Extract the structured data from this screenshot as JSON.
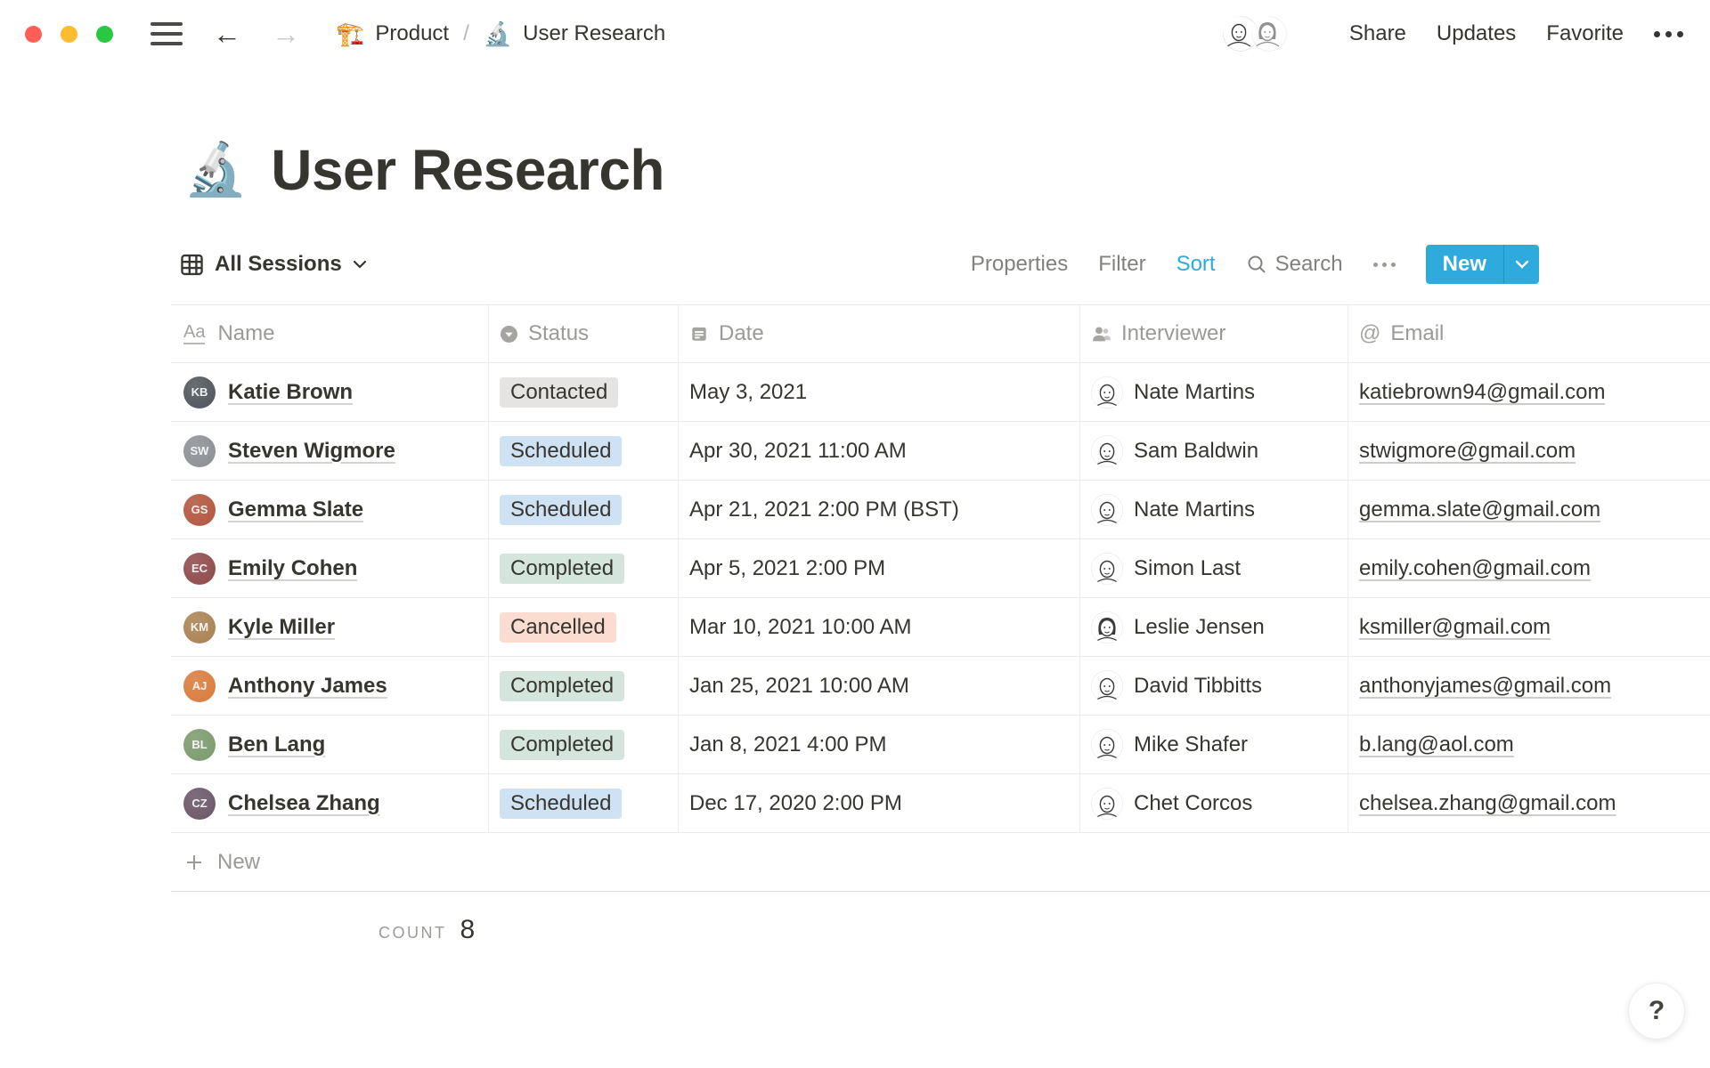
{
  "topbar": {
    "breadcrumb": {
      "workspace_icon": "🏗️",
      "workspace": "Product",
      "separator": "/",
      "page_icon": "🔬",
      "page": "User Research"
    },
    "actions": {
      "share": "Share",
      "updates": "Updates",
      "favorite": "Favorite"
    }
  },
  "page": {
    "icon": "🔬",
    "title": "User Research"
  },
  "toolbar": {
    "view_label": "All Sessions",
    "properties": "Properties",
    "filter": "Filter",
    "sort": "Sort",
    "search": "Search",
    "new_label": "New",
    "accent_color": "#2EAADC"
  },
  "table": {
    "columns": [
      {
        "label": "Name",
        "icon": "text-icon"
      },
      {
        "label": "Status",
        "icon": "select-icon"
      },
      {
        "label": "Date",
        "icon": "calendar-icon"
      },
      {
        "label": "Interviewer",
        "icon": "person-icon"
      },
      {
        "label": "Email",
        "icon": "at-icon"
      }
    ],
    "status_styles": {
      "Contacted": "#E5E4E2",
      "Scheduled": "#CFE2F4",
      "Completed": "#D3E5DC",
      "Cancelled": "#FADCD0"
    },
    "rows": [
      {
        "name": "Katie Brown",
        "status": "Contacted",
        "date": "May 3, 2021",
        "interviewer": "Nate Martins",
        "email": "katiebrown94@gmail.com",
        "avatar_color": "#50565c"
      },
      {
        "name": "Steven Wigmore",
        "status": "Scheduled",
        "date": "Apr 30, 2021 11:00 AM",
        "interviewer": "Sam Baldwin",
        "email": "stwigmore@gmail.com",
        "avatar_color": "#8c8f94"
      },
      {
        "name": "Gemma Slate",
        "status": "Scheduled",
        "date": "Apr 21, 2021 2:00 PM (BST)",
        "interviewer": "Nate Martins",
        "email": "gemma.slate@gmail.com",
        "avatar_color": "#b2563f"
      },
      {
        "name": "Emily Cohen",
        "status": "Completed",
        "date": "Apr 5, 2021 2:00 PM",
        "interviewer": "Simon Last",
        "email": "emily.cohen@gmail.com",
        "avatar_color": "#8f4a4a"
      },
      {
        "name": "Kyle Miller",
        "status": "Cancelled",
        "date": "Mar 10, 2021 10:00 AM",
        "interviewer": "Leslie Jensen",
        "email": "ksmiller@gmail.com",
        "avatar_color": "#a98253"
      },
      {
        "name": "Anthony James",
        "status": "Completed",
        "date": "Jan 25, 2021 10:00 AM",
        "interviewer": "David Tibbitts",
        "email": "anthonyjames@gmail.com",
        "avatar_color": "#d97b3c"
      },
      {
        "name": "Ben Lang",
        "status": "Completed",
        "date": "Jan 8, 2021 4:00 PM",
        "interviewer": "Mike Shafer",
        "email": "b.lang@aol.com",
        "avatar_color": "#7c9a6d"
      },
      {
        "name": "Chelsea Zhang",
        "status": "Scheduled",
        "date": "Dec 17, 2020 2:00 PM",
        "interviewer": "Chet Corcos",
        "email": "chelsea.zhang@gmail.com",
        "avatar_color": "#6b5668"
      }
    ],
    "new_row_label": "New",
    "footer": {
      "count_label": "COUNT",
      "count_value": "8"
    }
  },
  "help_label": "?"
}
